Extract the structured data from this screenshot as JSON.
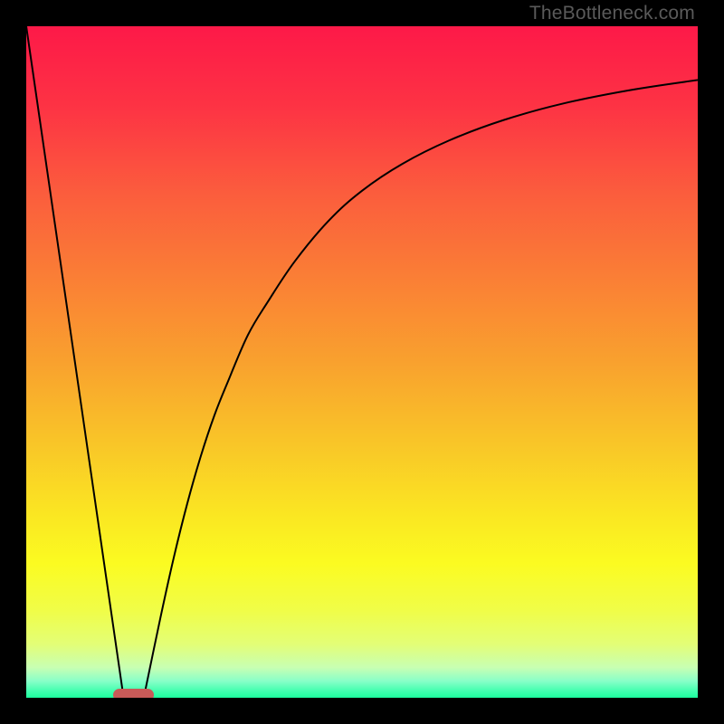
{
  "watermark": "TheBottleneck.com",
  "colors": {
    "frame": "#000000",
    "marker": "#c85a58",
    "curve": "#000000"
  },
  "gradient_stops": [
    {
      "offset": 0.0,
      "color": "#fd1948"
    },
    {
      "offset": 0.12,
      "color": "#fd3344"
    },
    {
      "offset": 0.25,
      "color": "#fb5d3d"
    },
    {
      "offset": 0.38,
      "color": "#fa8035"
    },
    {
      "offset": 0.5,
      "color": "#f9a12e"
    },
    {
      "offset": 0.62,
      "color": "#f9c528"
    },
    {
      "offset": 0.73,
      "color": "#fae722"
    },
    {
      "offset": 0.8,
      "color": "#fbfb21"
    },
    {
      "offset": 0.87,
      "color": "#f0fd48"
    },
    {
      "offset": 0.92,
      "color": "#e3fe76"
    },
    {
      "offset": 0.955,
      "color": "#c8ffb3"
    },
    {
      "offset": 0.975,
      "color": "#89ffc8"
    },
    {
      "offset": 0.99,
      "color": "#42ffaf"
    },
    {
      "offset": 1.0,
      "color": "#1dff9e"
    }
  ],
  "chart_data": {
    "type": "line",
    "title": "",
    "xlabel": "",
    "ylabel": "",
    "xlim": [
      0,
      100
    ],
    "ylim": [
      0,
      100
    ],
    "legend": false,
    "grid": false,
    "series": [
      {
        "name": "left-line",
        "x": [
          0,
          14.5
        ],
        "y": [
          100,
          0
        ]
      },
      {
        "name": "right-curve",
        "x": [
          17.5,
          20,
          22,
          24,
          26,
          28,
          30,
          33,
          36,
          40,
          45,
          50,
          56,
          63,
          71,
          80,
          90,
          100
        ],
        "y": [
          0,
          12,
          21,
          29,
          36,
          42,
          47,
          54,
          59,
          65,
          71,
          75.5,
          79.5,
          83,
          86,
          88.5,
          90.5,
          92
        ]
      }
    ],
    "annotations": [
      {
        "type": "marker",
        "name": "optimal-zone",
        "x_start": 13,
        "x_end": 19,
        "y": 0.5,
        "color": "#c85a58"
      }
    ],
    "watermark": "TheBottleneck.com"
  }
}
